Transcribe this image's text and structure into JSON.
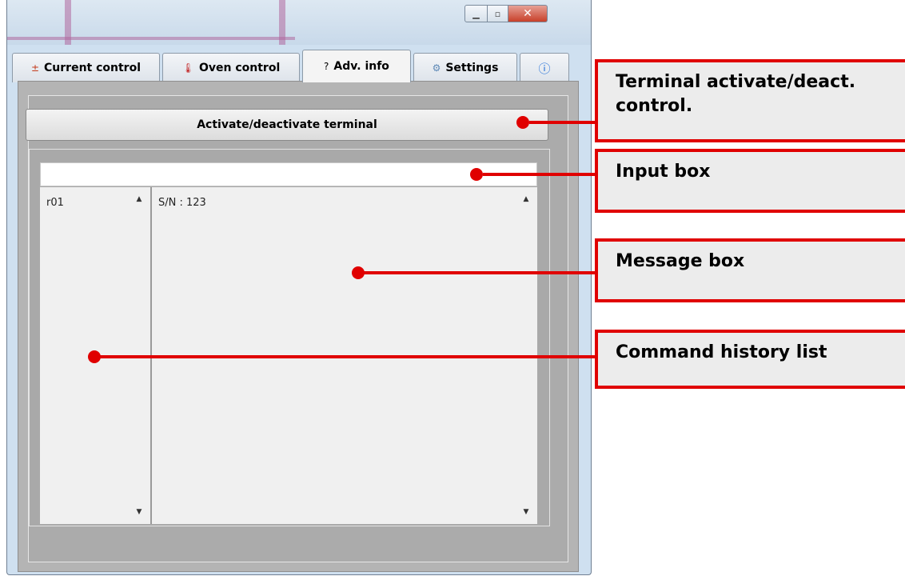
{
  "tabs": [
    {
      "label": "Current control",
      "icon": "current-icon"
    },
    {
      "label": "Oven control",
      "icon": "thermometer-icon"
    },
    {
      "label": "Adv. info",
      "icon": "question-icon"
    },
    {
      "label": "Settings",
      "icon": "gear-icon"
    },
    {
      "label": "",
      "icon": "info-icon"
    }
  ],
  "activate_button": "Activate/deactivate terminal",
  "input_box": {
    "value": ""
  },
  "command_history": [
    "r01"
  ],
  "messages": [
    "S/N : 123"
  ],
  "annotations": {
    "terminal": "Terminal activate/deact. control.",
    "input": "Input box",
    "message": "Message box",
    "history": "Command history list"
  },
  "colors": {
    "annotation": "#e00000",
    "close_button": "#c8402a"
  }
}
